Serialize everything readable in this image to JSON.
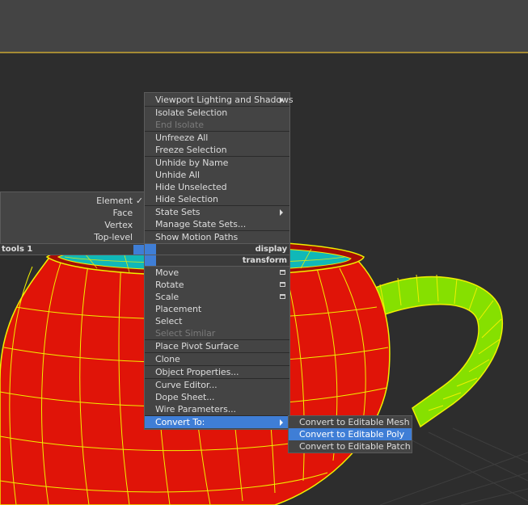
{
  "main_menu": {
    "items": [
      {
        "label": "Viewport Lighting and Shadows"
      },
      {
        "label": "Isolate Selection"
      },
      {
        "label": "End Isolate"
      },
      {
        "label": "Unfreeze All"
      },
      {
        "label": "Freeze Selection"
      },
      {
        "label": "Unhide by Name"
      },
      {
        "label": "Unhide All"
      },
      {
        "label": "Hide Unselected"
      },
      {
        "label": "Hide Selection"
      },
      {
        "label": "State Sets"
      },
      {
        "label": "Manage State Sets..."
      },
      {
        "label": "Show Motion Paths"
      }
    ],
    "headers": {
      "display": "display",
      "transform": "transform"
    },
    "transform_items": [
      {
        "label": "Move"
      },
      {
        "label": "Rotate"
      },
      {
        "label": "Scale"
      },
      {
        "label": "Placement"
      },
      {
        "label": "Select"
      },
      {
        "label": "Select Similar"
      },
      {
        "label": "Place Pivot Surface"
      },
      {
        "label": "Clone"
      },
      {
        "label": "Object Properties..."
      },
      {
        "label": "Curve Editor..."
      },
      {
        "label": "Dope Sheet..."
      },
      {
        "label": "Wire Parameters..."
      },
      {
        "label": "Convert To:"
      }
    ]
  },
  "left_menu": {
    "items": [
      {
        "label": "Element",
        "check": "✓"
      },
      {
        "label": "Face"
      },
      {
        "label": "Vertex"
      },
      {
        "label": "Top-level"
      }
    ],
    "header": "tools 1"
  },
  "submenu": {
    "items": [
      {
        "label": "Convert to Editable Mesh"
      },
      {
        "label": "Convert to Editable Poly"
      },
      {
        "label": "Convert to Editable Patch"
      }
    ]
  },
  "colors": {
    "menu_bg": "#444444",
    "highlight": "#3f7ed6",
    "teapot_red": "#e01408",
    "wire_yellow": "#f0f000",
    "handle_green": "#86e000",
    "interior_cyan": "#10b8b8",
    "top_accent": "#a58a34"
  }
}
